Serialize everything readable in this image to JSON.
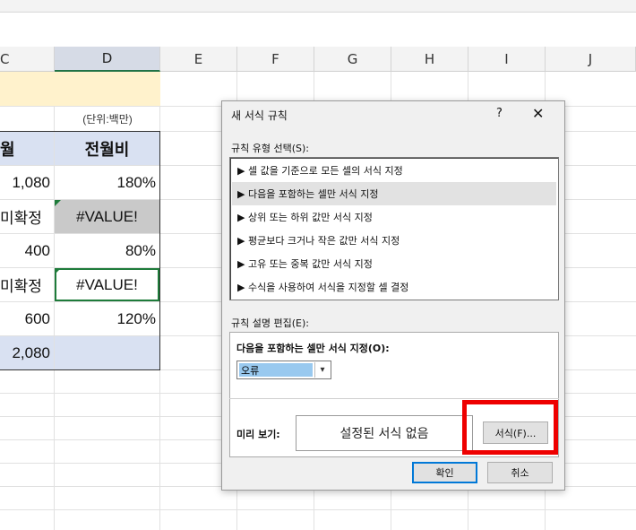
{
  "columns": [
    "C",
    "D",
    "E",
    "F",
    "G",
    "H",
    "I",
    "J"
  ],
  "sheet": {
    "unit_note": "(단위:백만)",
    "header_c": "월",
    "header_d": "전월비",
    "rows": [
      {
        "c": "1,080",
        "d": "180%"
      },
      {
        "c": "미확정",
        "d": "#VALUE!"
      },
      {
        "c": "400",
        "d": "80%"
      },
      {
        "c": "미확정",
        "d": "#VALUE!"
      },
      {
        "c": "600",
        "d": "120%"
      },
      {
        "c": "2,080",
        "d": ""
      }
    ]
  },
  "dialog": {
    "title": "새 서식 규칙",
    "help": "?",
    "close": "✕",
    "rule_type_label": "규칙 유형 선택(S):",
    "rule_types": [
      "▶ 셀 값을 기준으로 모든 셀의 서식 지정",
      "▶ 다음을 포함하는 셀만 서식 지정",
      "▶ 상위 또는 하위 값만 서식 지정",
      "▶ 평균보다 크거나 작은 값만 서식 지정",
      "▶ 고유 또는 중복 값만 서식 지정",
      "▶ 수식을 사용하여 서식을 지정할 셀 결정"
    ],
    "selected_rule_index": 1,
    "edit_label": "규칙 설명 편집(E):",
    "format_only_label": "다음을 포함하는 셀만 서식 지정(O):",
    "combo_value": "오류",
    "preview_label": "미리 보기:",
    "preview_text": "설정된 서식 없음",
    "format_button": "서식(F)...",
    "ok_button": "확인",
    "cancel_button": "취소"
  }
}
